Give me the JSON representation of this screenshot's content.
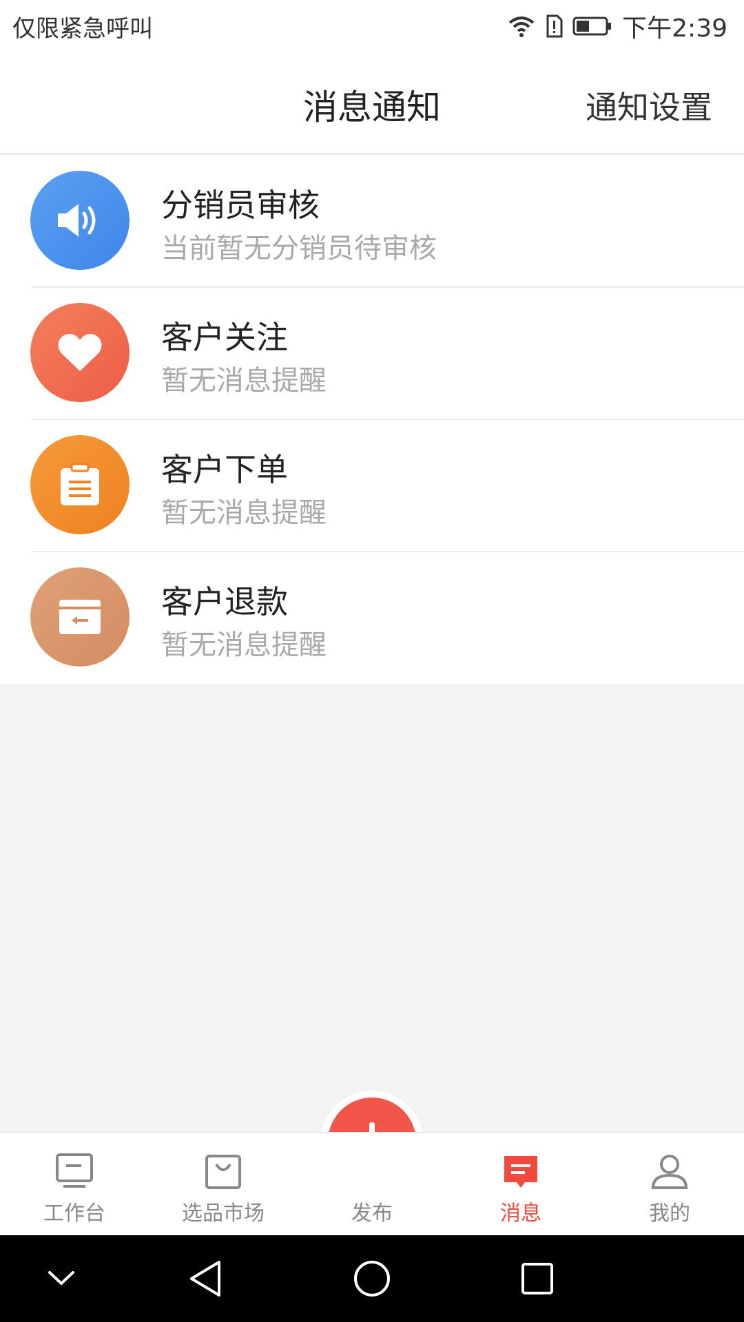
{
  "status_bar": {
    "carrier": "仅限紧急呼叫",
    "time": "下午2:39",
    "icons": [
      "wifi-icon",
      "sim-alert-icon",
      "battery-icon"
    ]
  },
  "header": {
    "title": "消息通知",
    "settings_label": "通知设置"
  },
  "notifications": [
    {
      "title": "分销员审核",
      "subtitle": "当前暂无分销员待审核",
      "icon": "speaker-icon",
      "color": "#4e94ee"
    },
    {
      "title": "客户关注",
      "subtitle": "暂无消息提醒",
      "icon": "heart-icon",
      "color": "#f0694e"
    },
    {
      "title": "客户下单",
      "subtitle": "暂无消息提醒",
      "icon": "clipboard-icon",
      "color": "#f08a24"
    },
    {
      "title": "客户退款",
      "subtitle": "暂无消息提醒",
      "icon": "refund-box-icon",
      "color": "#d9946a"
    }
  ],
  "tabbar": {
    "tabs": [
      {
        "label": "工作台",
        "icon": "workbench-icon",
        "active": false
      },
      {
        "label": "选品市场",
        "icon": "shopping-bag-icon",
        "active": false
      },
      {
        "label": "发布",
        "icon": "plus-icon",
        "active": false
      },
      {
        "label": "消息",
        "icon": "message-icon",
        "active": true
      },
      {
        "label": "我的",
        "icon": "person-icon",
        "active": false
      }
    ],
    "active_color": "#f0493e"
  },
  "system_nav": {
    "buttons": [
      "collapse-icon",
      "back-icon",
      "home-icon",
      "recents-icon"
    ]
  }
}
